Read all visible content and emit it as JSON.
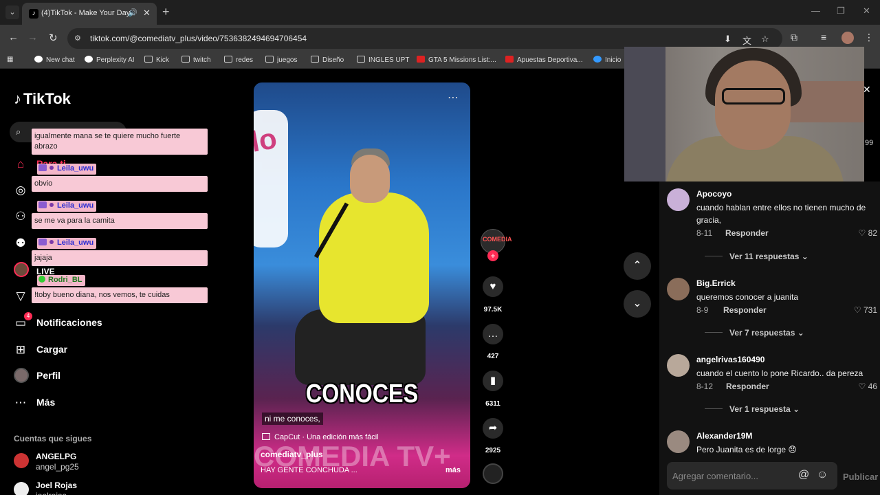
{
  "browser": {
    "tab_title": "(4)TikTok - Make Your Day",
    "url": "tiktok.com/@comediatv_plus/video/7536382494694706454",
    "bookmarks": [
      {
        "label": "New chat",
        "icon": "chat-icon"
      },
      {
        "label": "Perplexity AI",
        "icon": "perplexity-icon"
      },
      {
        "label": "Kick",
        "icon": "folder-icon"
      },
      {
        "label": "twitch",
        "icon": "folder-icon"
      },
      {
        "label": "redes",
        "icon": "folder-icon"
      },
      {
        "label": "juegos",
        "icon": "folder-icon"
      },
      {
        "label": "Diseño",
        "icon": "folder-icon"
      },
      {
        "label": "INGLES UPT",
        "icon": "folder-icon"
      },
      {
        "label": "GTA 5 Missions List:...",
        "icon": "b-logo-icon"
      },
      {
        "label": "Apuestas Deportiva...",
        "icon": "b-logo-icon"
      },
      {
        "label": "Inicio",
        "icon": "c-logo-icon"
      }
    ]
  },
  "sidebar": {
    "logo": "TikTok",
    "nav": [
      {
        "label": "Para ti",
        "icon": "home-icon"
      },
      {
        "label": "Explorar",
        "icon": "compass-icon"
      },
      {
        "label": "Siguiendo",
        "icon": "following-icon"
      },
      {
        "label": "Amigos",
        "icon": "friends-icon"
      },
      {
        "label": "LIVE",
        "icon": "live-icon"
      },
      {
        "label": "Mensajes",
        "icon": "send-icon"
      },
      {
        "label": "Notificaciones",
        "icon": "bell-icon",
        "badge": "4"
      },
      {
        "label": "Cargar",
        "icon": "plus-square-icon"
      },
      {
        "label": "Perfil",
        "icon": "profile-avatar"
      },
      {
        "label": "Más",
        "icon": "more-icon"
      }
    ],
    "following_title": "Cuentas que sigues",
    "following": [
      {
        "name": "ANGELPG",
        "handle": "angel_pg25"
      },
      {
        "name": "Joel Rojas",
        "handle": "joelrojas"
      }
    ]
  },
  "chat": [
    {
      "text": "igualmente mana se te quiere mucho fuerte abrazo"
    },
    {
      "user": "Leila_uwu",
      "text": "obvio"
    },
    {
      "user": "Leila_uwu",
      "text": "se me va para la camita"
    },
    {
      "user": "Leila_uwu",
      "text": "jajaja"
    },
    {
      "user": "Rodri_BL",
      "text": "!toby bueno diana, nos vemos, te cuidas"
    }
  ],
  "video": {
    "caption": "CONOCES",
    "subtitle": "ni me conoces,",
    "capcut": "CapCut · Una edición más fácil",
    "author": "comediatv_plus",
    "description": "HAY GENTE CONCHUDA ...",
    "more": "más",
    "watermark": "COMEDIA TV+",
    "sign_letter": "lo"
  },
  "actions": {
    "likes": "97.5K",
    "comments": "427",
    "saves": "6311",
    "shares": "2925"
  },
  "comments": [
    {
      "user": "Apocoyo",
      "text": "cuando hablan entre ellos no tienen mucho de gracia,",
      "date": "8-11",
      "reply": "Responder",
      "likes": "82",
      "more": "Ver 11 respuestas"
    },
    {
      "user": "Big.Errick",
      "text": "queremos conocer a juanita",
      "date": "8-9",
      "reply": "Responder",
      "likes": "731",
      "more": "Ver 7 respuestas"
    },
    {
      "user": "angelrivas160490",
      "text": "cuando el cuento lo pone Ricardo.. da pereza",
      "date": "8-12",
      "reply": "Responder",
      "likes": "46",
      "more": "Ver 1 respuesta"
    },
    {
      "user": "Alexander19M",
      "text": "Pero Juanita es de lorge 😞"
    }
  ],
  "comment_box": {
    "placeholder": "Agregar comentario...",
    "publish": "Publicar"
  },
  "partial_count": "99"
}
